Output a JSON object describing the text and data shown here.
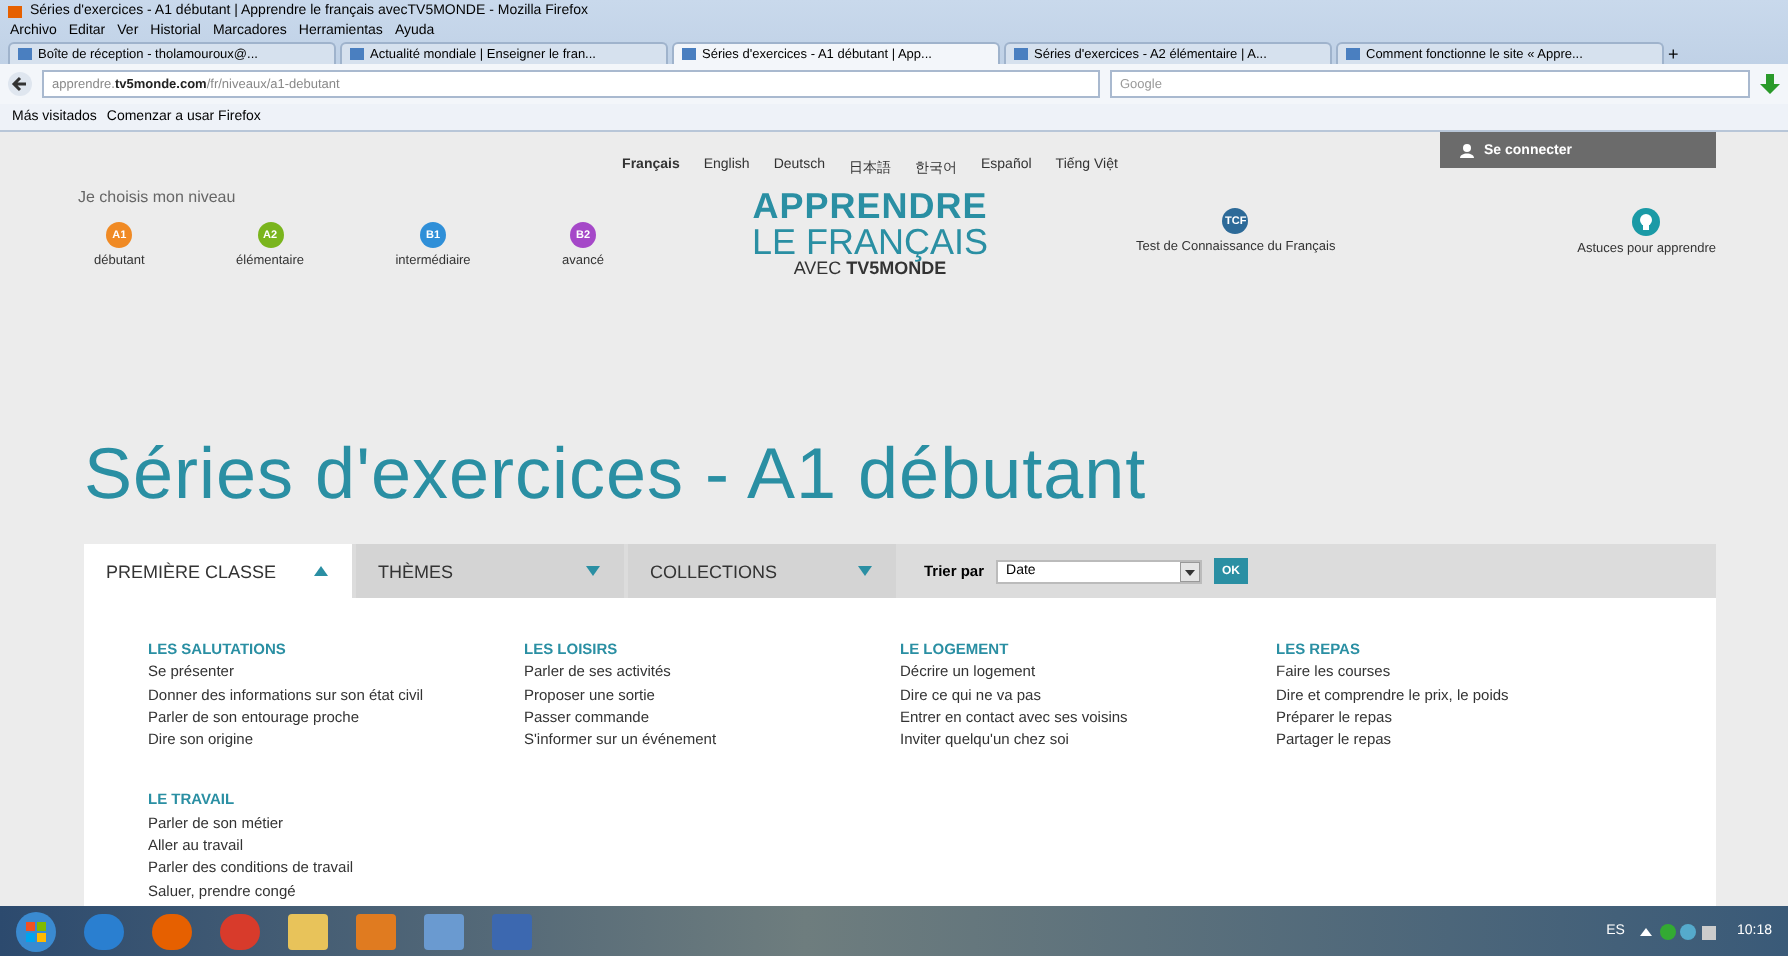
{
  "browser": {
    "title": "Séries d'exercices - A1 débutant | Apprendre le français avecTV5MONDE - Mozilla Firefox",
    "menu": [
      "Archivo",
      "Editar",
      "Ver",
      "Historial",
      "Marcadores",
      "Herramientas",
      "Ayuda"
    ],
    "tabs": [
      {
        "label": "Boîte de réception - tholamouroux@...",
        "selected": false
      },
      {
        "label": "Actualité mondiale | Enseigner le fran...",
        "selected": false
      },
      {
        "label": "Séries d'exercices - A1 débutant | App...",
        "selected": true
      },
      {
        "label": "Séries d'exercices - A2 élémentaire | A...",
        "selected": false
      },
      {
        "label": "Comment fonctionne le site « Appre...",
        "selected": false
      }
    ],
    "new_tab": "+",
    "url": {
      "prefix": "apprendre.",
      "domain": "tv5monde.com",
      "path": "/fr/niveaux/a1-debutant"
    },
    "search_placeholder": "Google",
    "bookmarks": [
      "Más visitados",
      "Comenzar a usar Firefox"
    ]
  },
  "site": {
    "languages": [
      {
        "label": "Français",
        "selected": true
      },
      {
        "label": "English",
        "selected": false
      },
      {
        "label": "Deutsch",
        "selected": false
      },
      {
        "label": "日本語",
        "selected": false
      },
      {
        "label": "한국어",
        "selected": false
      },
      {
        "label": "Español",
        "selected": false
      },
      {
        "label": "Tiếng Việt",
        "selected": false
      }
    ],
    "login": "Se connecter",
    "level_prompt": "Je choisis mon niveau",
    "levels": [
      {
        "badge": "A1",
        "label": "débutant",
        "color": "#f08a24"
      },
      {
        "badge": "A2",
        "label": "élémentaire",
        "color": "#7ab51d"
      },
      {
        "badge": "B1",
        "label": "intermédiaire",
        "color": "#2f8fd8"
      },
      {
        "badge": "B2",
        "label": "avancé",
        "color": "#a548c8"
      }
    ],
    "logo": {
      "line1": "APPRENDRE",
      "line2": "LE FRANÇAIS",
      "line3": "AVEC",
      "brand": "TV5MONDE"
    },
    "tcf": {
      "badge": "TCF",
      "label": "Test de Connaissance du Français"
    },
    "tips": "Astuces pour apprendre",
    "heading": "Séries d'exercices - A1 débutant",
    "filter_tabs": [
      {
        "label": "PREMIÈRE CLASSE",
        "selected": true
      },
      {
        "label": "THÈMES",
        "selected": false
      },
      {
        "label": "COLLECTIONS",
        "selected": false
      }
    ],
    "sort": {
      "label": "Trier par",
      "value": "Date",
      "ok": "OK"
    },
    "categories": [
      {
        "title": "LES SALUTATIONS",
        "items": [
          "Se présenter",
          "Donner des informations sur son état civil",
          "Parler de son entourage proche",
          "Dire son origine"
        ]
      },
      {
        "title": "LES LOISIRS",
        "items": [
          "Parler de ses activités",
          "Proposer une sortie",
          "Passer commande",
          "S'informer sur un événement"
        ]
      },
      {
        "title": "LE LOGEMENT",
        "items": [
          "Décrire un logement",
          "Dire ce qui ne va pas",
          "Entrer en contact avec ses voisins",
          "Inviter quelqu'un chez soi"
        ]
      },
      {
        "title": "LES REPAS",
        "items": [
          "Faire les courses",
          "Dire et comprendre le prix, le poids",
          "Préparer le repas",
          "Partager le repas"
        ]
      },
      {
        "title": "LE TRAVAIL",
        "items": [
          "Parler de son métier",
          "Aller au travail",
          "Parler des conditions de travail",
          "Saluer, prendre congé"
        ]
      }
    ]
  },
  "taskbar": {
    "language": "ES",
    "clock": "10:18"
  }
}
